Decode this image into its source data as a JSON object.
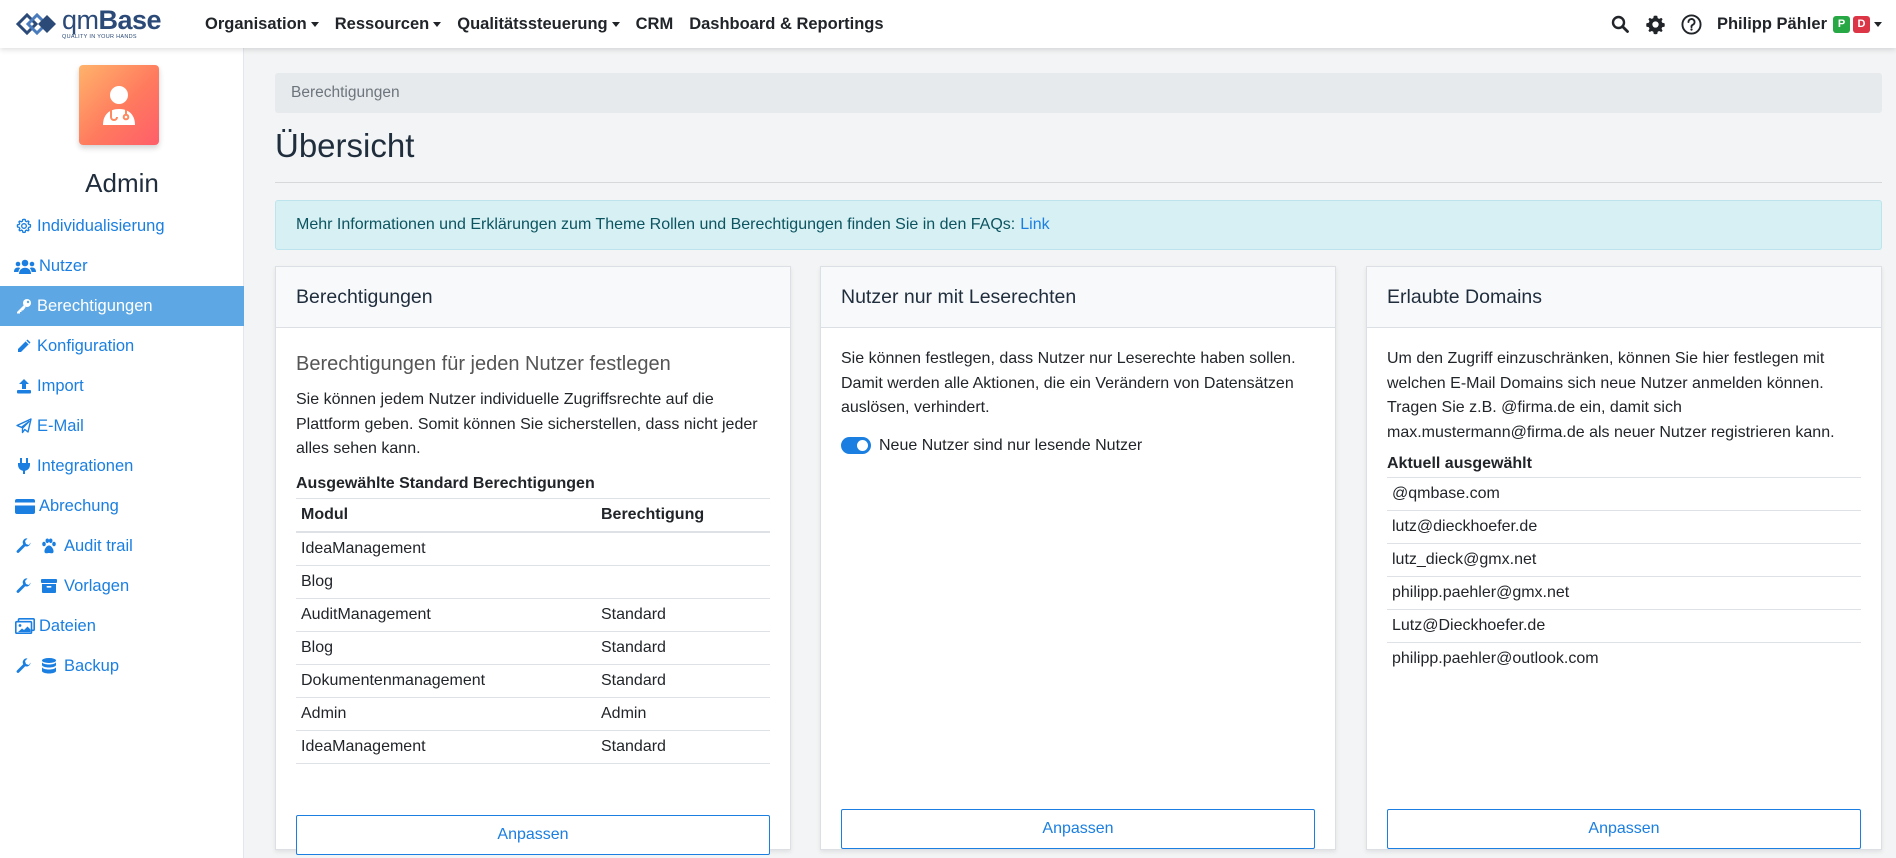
{
  "brand": {
    "name_prefix": "qm",
    "name_suffix": "Base",
    "tagline": "QUALITY IN YOUR HANDS"
  },
  "nav": {
    "items": [
      {
        "label": "Organisation",
        "dropdown": true
      },
      {
        "label": "Ressourcen",
        "dropdown": true
      },
      {
        "label": "Qualitätssteuerung",
        "dropdown": true
      },
      {
        "label": "CRM",
        "dropdown": false
      },
      {
        "label": "Dashboard & Reportings",
        "dropdown": false
      }
    ],
    "icons": [
      "search-icon",
      "gear-icon",
      "help-icon"
    ],
    "user": {
      "name": "Philipp Pähler",
      "badge_p": "P",
      "badge_d": "D",
      "badge_p_color": "#28a745",
      "badge_d_color": "#dc3545"
    }
  },
  "sidebar": {
    "title": "Admin",
    "items": [
      {
        "label": "Individualisierung",
        "icon": "gear-icon",
        "active": false
      },
      {
        "label": "Nutzer",
        "icon": "users-icon",
        "active": false
      },
      {
        "label": "Berechtigungen",
        "icon": "key-icon",
        "active": true
      },
      {
        "label": "Konfiguration",
        "icon": "pencil-icon",
        "active": false
      },
      {
        "label": "Import",
        "icon": "upload-icon",
        "active": false
      },
      {
        "label": "E-Mail",
        "icon": "paper-plane-icon",
        "active": false
      },
      {
        "label": "Integrationen",
        "icon": "plug-icon",
        "active": false
      },
      {
        "label": "Abrechung",
        "icon": "credit-card-icon",
        "active": false
      },
      {
        "label": "Audit trail",
        "icon": "wrench-paw-icon",
        "active": false
      },
      {
        "label": "Vorlagen",
        "icon": "wrench-box-icon",
        "active": false
      },
      {
        "label": "Dateien",
        "icon": "images-icon",
        "active": false
      },
      {
        "label": "Backup",
        "icon": "wrench-database-icon",
        "active": false
      }
    ]
  },
  "breadcrumb": "Berechtigungen",
  "page_title": "Übersicht",
  "alert": {
    "text": "Mehr Informationen und Erklärungen zum Theme Rollen und Berechtigungen finden Sie in den FAQs:",
    "link": "Link"
  },
  "cards": {
    "permissions": {
      "title": "Berechtigungen",
      "lead": "Berechtigungen für jeden Nutzer festlegen",
      "text": "Sie können jedem Nutzer individuelle Zugriffsrechte auf die Plattform geben. Somit können Sie sicherstellen, dass nicht jeder alles sehen kann.",
      "subhead": "Ausgewählte Standard Berechtigungen",
      "columns": [
        "Modul",
        "Berechtigung"
      ],
      "rows": [
        [
          "IdeaManagement",
          ""
        ],
        [
          "Blog",
          ""
        ],
        [
          "AuditManagement",
          "Standard"
        ],
        [
          "Blog",
          "Standard"
        ],
        [
          "Dokumentenmanagement",
          "Standard"
        ],
        [
          "Admin",
          "Admin"
        ],
        [
          "IdeaManagement",
          "Standard"
        ]
      ],
      "button": "Anpassen"
    },
    "readonly": {
      "title": "Nutzer nur mit Leserechten",
      "text": "Sie können festlegen, dass Nutzer nur Leserechte haben sollen. Damit werden alle Aktionen, die ein Verändern von Datensätzen auslösen, verhindert.",
      "toggle_label": "Neue Nutzer sind nur lesende Nutzer",
      "toggle_on": true,
      "button": "Anpassen"
    },
    "domains": {
      "title": "Erlaubte Domains",
      "text": "Um den Zugriff einzuschränken, können Sie hier festlegen mit welchen E-Mail Domains sich neue Nutzer anmelden können. Tragen Sie z.B. @firma.de ein, damit sich max.mustermann@firma.de als neuer Nutzer registrieren kann.",
      "subhead": "Aktuell ausgewählt",
      "items": [
        "@qmbase.com",
        "lutz@dieckhoefer.de",
        "lutz_dieck@gmx.net",
        "philipp.paehler@gmx.net",
        "Lutz@Dieckhoefer.de",
        "philipp.paehler@outlook.com"
      ],
      "button": "Anpassen"
    }
  },
  "colors": {
    "accent": "#1a7fe0",
    "sidebar_active": "#5da8e4",
    "alert_bg": "#d6f0f4"
  }
}
